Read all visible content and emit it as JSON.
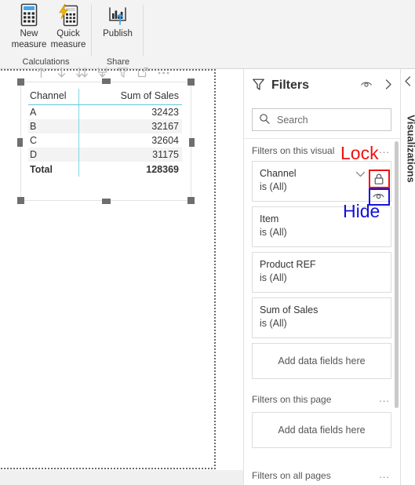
{
  "ribbon": {
    "groups": [
      {
        "label": "Calculations",
        "buttons": [
          {
            "line1": "New",
            "line2": "measure",
            "icon": "calculator-icon"
          },
          {
            "line1": "Quick",
            "line2": "measure",
            "icon": "calculator-lightning-icon"
          }
        ]
      },
      {
        "label": "Share",
        "buttons": [
          {
            "line1": "Publish",
            "line2": "",
            "icon": "publish-icon"
          }
        ]
      }
    ]
  },
  "visual": {
    "toolbar_icons": [
      "drill-up-arrow-icon",
      "drill-down-arrow-icon",
      "expand-all-down-icon",
      "go-to-next-level-icon",
      "filter-funnel-icon",
      "focus-mode-icon",
      "more-options-icon"
    ],
    "table": {
      "columns": [
        "Channel",
        "Sum of Sales"
      ],
      "rows": [
        {
          "channel": "A",
          "sales": "32423"
        },
        {
          "channel": "B",
          "sales": "32167"
        },
        {
          "channel": "C",
          "sales": "32604"
        },
        {
          "channel": "D",
          "sales": "31175"
        }
      ],
      "total": {
        "label": "Total",
        "value": "128369"
      }
    }
  },
  "filters_pane": {
    "title": "Filters",
    "header_icons": [
      "eye-icon",
      "chevron-right-icon"
    ],
    "search": {
      "placeholder": "Search",
      "icon": "search-icon"
    },
    "sections": [
      {
        "label": "Filters on this visual",
        "dots": "...",
        "cards": [
          {
            "name": "Channel",
            "value": "is (All)",
            "has_chevron": true,
            "has_lock": true,
            "has_eye": true
          },
          {
            "name": "Item",
            "value": "is (All)",
            "has_chevron": false,
            "has_lock": false,
            "has_eye": false
          },
          {
            "name": "Product REF",
            "value": "is (All)",
            "has_chevron": false,
            "has_lock": false,
            "has_eye": false
          },
          {
            "name": "Sum of Sales",
            "value": "is (All)",
            "has_chevron": false,
            "has_lock": false,
            "has_eye": false
          }
        ],
        "placeholder": "Add data fields here"
      },
      {
        "label": "Filters on this page",
        "dots": "...",
        "cards": [],
        "placeholder": "Add data fields here"
      },
      {
        "label": "Filters on all pages",
        "dots": "...",
        "cards": [],
        "placeholder": ""
      }
    ]
  },
  "annotations": [
    {
      "text": "Lock",
      "color": "#ee1111",
      "target": "lock-toggle-icon"
    },
    {
      "text": "Hide",
      "color": "#1111dd",
      "target": "hide-eye-toggle-icon"
    }
  ],
  "visualizations_pane": {
    "label": "Visualizations",
    "chevron": "chevron-left-icon"
  }
}
